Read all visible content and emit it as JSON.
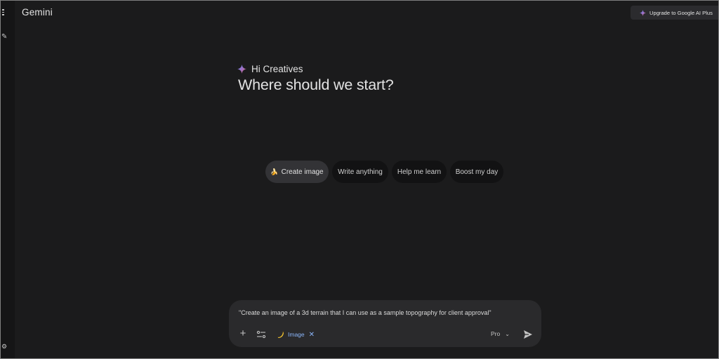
{
  "app": {
    "title": "Gemini"
  },
  "header": {
    "upgrade_label": "Upgrade to Google AI Plus"
  },
  "greeting": {
    "hello": "Hi Creatives",
    "headline": "Where should we start?"
  },
  "suggestions": [
    {
      "label": "Create image",
      "emoji": "🍌",
      "active": true
    },
    {
      "label": "Write anything",
      "active": false
    },
    {
      "label": "Help me learn",
      "active": false
    },
    {
      "label": "Boost my day",
      "active": false
    }
  ],
  "composer": {
    "prompt": "\"Create an image of a 3d terrain that I can use as a sample topography for client approval\"",
    "tool_chip_label": "Image",
    "tool_chip_close": "✕",
    "add_glyph": "+",
    "model_label": "Pro",
    "model_chevron": "⌄"
  },
  "icons": {
    "menu": "menu-icon",
    "new_chat": "edit-icon",
    "settings": "settings-icon",
    "gemini_spark": "gemini-spark-icon",
    "add": "plus-icon",
    "tools": "tools-icon",
    "banana": "banana-icon",
    "send": "send-icon"
  },
  "colors": {
    "background": "#1b1b1c",
    "composer": "#2a2a2c",
    "chip_active": "#333336",
    "accent_blue": "#8ab4f8",
    "text_primary": "#e3e3e3"
  }
}
